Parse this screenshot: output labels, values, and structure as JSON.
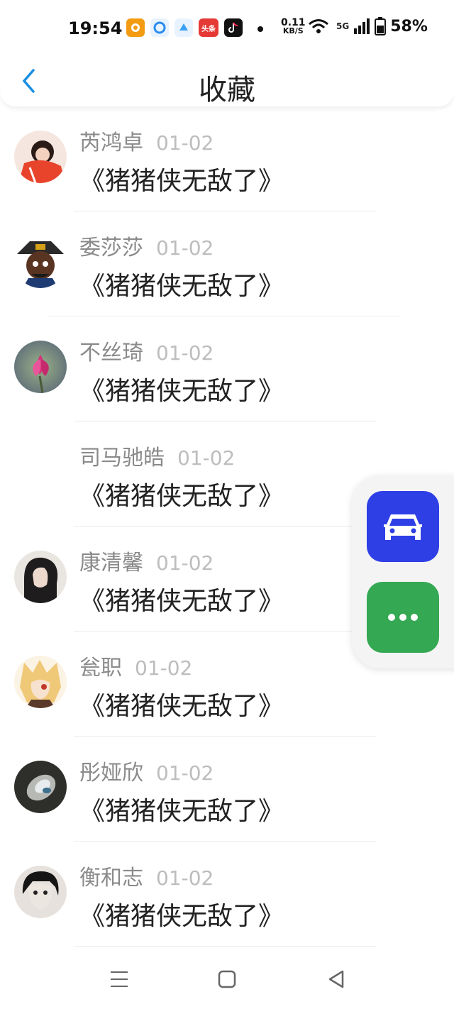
{
  "status_bar": {
    "time": "19:54",
    "net_speed_value": "0.11",
    "net_speed_unit": "KB/S",
    "signal_label": "5G",
    "battery": "58%",
    "app_icons": [
      "app-orange-icon",
      "browser-blue-icon",
      "browser-lightblue-icon",
      "toutiao-icon",
      "tiktok-icon"
    ],
    "toutiao_label": "头条"
  },
  "header": {
    "title": "收藏",
    "back_icon": "chevron-left-icon",
    "accent_color": "#1a8fe3"
  },
  "items": [
    {
      "name": "芮鸿卓",
      "date": "01-02",
      "message": "《猪猪侠无敌了》",
      "avatar": "anime-avatar-red"
    },
    {
      "name": "委莎莎",
      "date": "01-02",
      "message": "《猪猪侠无敌了》",
      "avatar": "cartoon-official-avatar"
    },
    {
      "name": "不丝琦",
      "date": "01-02",
      "message": "《猪猪侠无敌了》",
      "avatar": "flower-avatar"
    },
    {
      "name": "司马驰皓",
      "date": "01-02",
      "message": "《猪猪侠无敌了》",
      "avatar": ""
    },
    {
      "name": "康清馨",
      "date": "01-02",
      "message": "《猪猪侠无敌了》",
      "avatar": "portrait-avatar"
    },
    {
      "name": "瓮职",
      "date": "01-02",
      "message": "《猪猪侠无敌了》",
      "avatar": "anime-avatar-blonde"
    },
    {
      "name": "彤娅欣",
      "date": "01-02",
      "message": "《猪猪侠无敌了》",
      "avatar": "stone-avatar"
    },
    {
      "name": "衡和志",
      "date": "01-02",
      "message": "《猪猪侠无敌了》",
      "avatar": "anime-avatar-dark"
    }
  ],
  "float_panel": {
    "car_button_icon": "car-icon",
    "car_button_color": "#2f3fe6",
    "more_button_icon": "more-dots-icon",
    "more_button_color": "#34a853"
  },
  "nav_bar": {
    "menu_icon": "menu-icon",
    "home_icon": "home-square-icon",
    "back_icon": "back-triangle-icon"
  }
}
